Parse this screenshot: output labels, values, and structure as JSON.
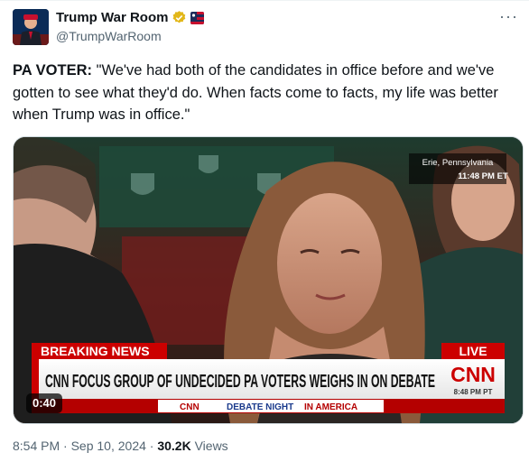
{
  "author": {
    "display_name": "Trump War Room",
    "handle": "@TrumpWarRoom"
  },
  "tweet": {
    "label": "PA VOTER:",
    "text": " \"We've had both of the candidates in office before and we've gotten to see what they'd do. When facts come to facts, my life was better when Trump was in office.\""
  },
  "video": {
    "location_line1": "Erie, Pennsylvania",
    "location_line2": "11:48 PM ET",
    "breaking_label": "BREAKING NEWS",
    "live_label": "LIVE",
    "headline": "CNN FOCUS GROUP OF UNDECIDED PA VOTERS WEIGHS IN ON DEBATE",
    "network": "CNN",
    "bug_time": "8:48 PM PT",
    "show_network": "CNN",
    "show_title_a": "DEBATE NIGHT",
    "show_title_b": "IN AMERICA",
    "duration": "0:40"
  },
  "meta": {
    "time": "8:54 PM",
    "sep1": " · ",
    "date": "Sep 10, 2024",
    "sep2": " · ",
    "views_count": "30.2K",
    "views_label": " Views"
  },
  "colors": {
    "cnn_red": "#cc0000",
    "verified_gold": "#e2b719",
    "text_secondary": "#536471"
  }
}
